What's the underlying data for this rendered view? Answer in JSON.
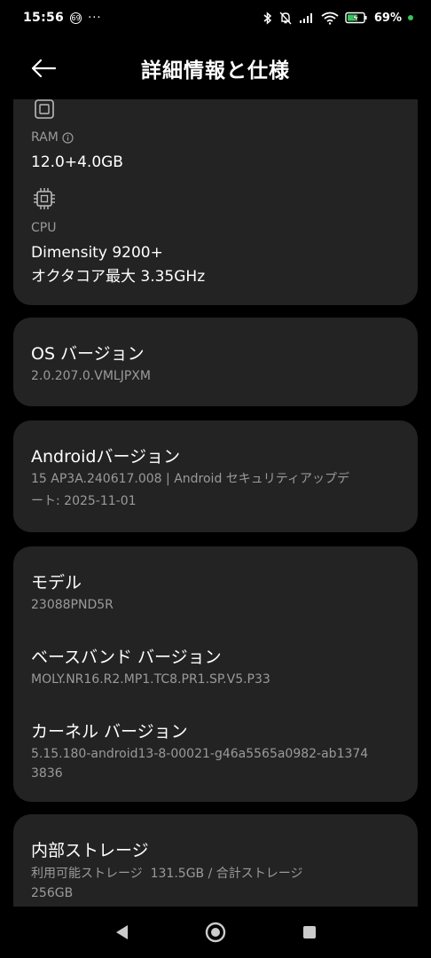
{
  "status_bar": {
    "time": "15:56",
    "badge": "69",
    "dots": "···",
    "battery_percent": "69%"
  },
  "app_bar": {
    "title": "詳細情報と仕様"
  },
  "hardware": {
    "ram": {
      "label": "RAM",
      "value": "12.0+4.0GB"
    },
    "cpu": {
      "label": "CPU",
      "value_line1": "Dimensity 9200+",
      "value_line2": "オクタコア最大 3.35GHz"
    }
  },
  "os": {
    "title": "OS バージョン",
    "value": "2.0.207.0.VMLJPXM"
  },
  "android": {
    "title": "Androidバージョン",
    "value_line1": "15 AP3A.240617.008 | Android セキュリティアップデ",
    "value_line2": "ート: 2025-11-01"
  },
  "device": {
    "model": {
      "title": "モデル",
      "value": "23088PND5R"
    },
    "baseband": {
      "title": "ベースバンド バージョン",
      "value": "MOLY.NR16.R2.MP1.TC8.PR1.SP.V5.P33"
    },
    "kernel": {
      "title": "カーネル バージョン",
      "value_line1": "5.15.180-android13-8-00021-g46a5565a0982-ab1374",
      "value_line2": "3836"
    }
  },
  "storage": {
    "title": "内部ストレージ",
    "value_line1": "利用可能ストレージ  131.5GB / 合計ストレージ",
    "value_line2": "256GB"
  },
  "icons": {
    "back": "arrow-left-icon",
    "ram": "memory-chip-icon",
    "cpu": "cpu-chip-icon",
    "info": "info-circle-icon",
    "nav_back": "triangle-back-icon",
    "nav_home": "circle-home-icon",
    "nav_recents": "square-recents-icon"
  },
  "colors": {
    "background": "#000000",
    "card": "#232323",
    "primary_text": "#ffffff",
    "secondary_text": "#9a9a9a",
    "battery_dot": "#34c759"
  }
}
